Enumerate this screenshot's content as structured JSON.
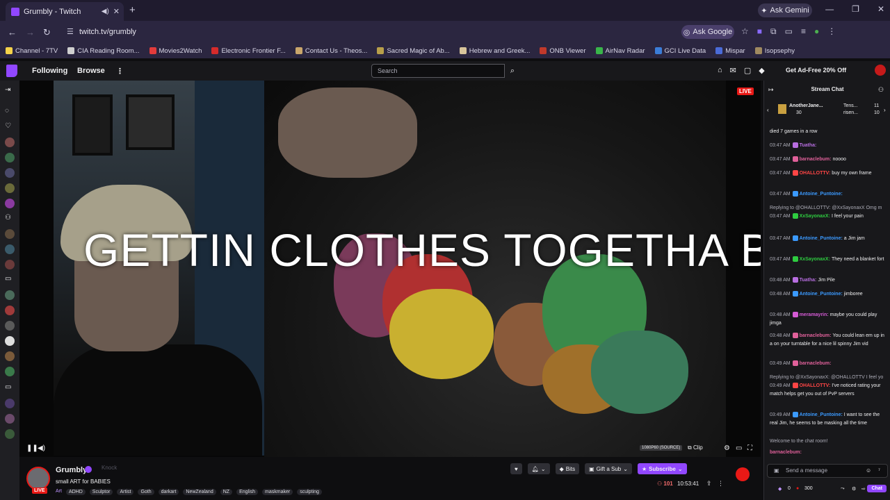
{
  "browser": {
    "tab_title": "Grumbly - Twitch",
    "new_tab": "+",
    "ask_gemini": "Ask Gemini",
    "url": "twitch.tv/grumbly",
    "ask_google": "Ask Google",
    "bookmarks": [
      {
        "label": "Channel - 7TV",
        "color": "#f5d24a"
      },
      {
        "label": "CIA Reading Room...",
        "color": "#cfcfcf"
      },
      {
        "label": "Movies2Watch",
        "color": "#e23b3b"
      },
      {
        "label": "Electronic Frontier F...",
        "color": "#d62b2b"
      },
      {
        "label": "Contact Us - Theos...",
        "color": "#c9a66b"
      },
      {
        "label": "Sacred Magic of Ab...",
        "color": "#b89f4a"
      },
      {
        "label": "Hebrew and Greek...",
        "color": "#d8c49a"
      },
      {
        "label": "ONB Viewer",
        "color": "#c0392b"
      },
      {
        "label": "AirNav Radar",
        "color": "#39b54a"
      },
      {
        "label": "GCI Live Data",
        "color": "#3b7dd8"
      },
      {
        "label": "Mispar",
        "color": "#4a6bd8"
      },
      {
        "label": "Isopsephy",
        "color": "#a08a60"
      }
    ]
  },
  "twitch": {
    "following": "Following",
    "browse": "Browse",
    "search_placeholder": "Search",
    "ad_free": "Get Ad-Free 20% Off",
    "notif_count": "8"
  },
  "video": {
    "live_badge": "LIVE",
    "overlay_text": "GETTIN CLOTHES TOGETHA BRB",
    "quality": "1080P60 (SOURCE)",
    "clip": "Clip"
  },
  "channel": {
    "name": "Grumbly",
    "live": "LIVE",
    "knock": "Knock",
    "title": "small ART for BABIES",
    "category": "Art",
    "tags": [
      "ADHD",
      "Sculptor",
      "Artist",
      "Goth",
      "darkart",
      "NewZealand",
      "NZ",
      "English",
      "maskmaker",
      "sculpting"
    ],
    "bits": "Bits",
    "gift_sub": "Gift a Sub",
    "subscribe": "Subscribe",
    "viewers": "101",
    "uptime": "10:53:41"
  },
  "chat": {
    "header": "Stream Chat",
    "gift_user1": "AnotherJane...",
    "gift_count1": "30",
    "gift_user2": "Tens...",
    "gift_count2": "11",
    "gift_user3": "risen...",
    "gift_count3": "10",
    "messages": [
      {
        "time": "",
        "user": "",
        "color": "#efeff1",
        "text": "died 7 games in a row"
      },
      {
        "time": "03:47 AM",
        "user": "Tuatha:",
        "color": "#b86ee0",
        "text": ""
      },
      {
        "time": "03:47 AM",
        "user": "barnaclebum:",
        "color": "#e0609a",
        "text": "noooo"
      },
      {
        "time": "03:47 AM",
        "user": "OHALLOTTV:",
        "color": "#ff4545",
        "text": "buy my own frame"
      },
      {
        "time": "03:47 AM",
        "user": "Antoine_Puntoine:",
        "color": "#3b9aff",
        "text": ""
      },
      {
        "time": "",
        "user": "",
        "color": "#adadb8",
        "text": "Replying to @OHALLOTTV: @XxSayonaxX Omg m"
      },
      {
        "time": "03:47 AM",
        "user": "XxSayonaxX:",
        "color": "#2ecc40",
        "text": "I feel your pain"
      },
      {
        "time": "03:47 AM",
        "user": "Antoine_Puntoine:",
        "color": "#3b9aff",
        "text": "a Jim jam"
      },
      {
        "time": "03:47 AM",
        "user": "XxSayonaxX:",
        "color": "#2ecc40",
        "text": "They need a blanket fort"
      },
      {
        "time": "03:48 AM",
        "user": "Tuatha:",
        "color": "#b86ee0",
        "text": "Jim Pile"
      },
      {
        "time": "03:48 AM",
        "user": "Antoine_Puntoine:",
        "color": "#3b9aff",
        "text": "jimboree"
      },
      {
        "time": "03:48 AM",
        "user": "meramayrin:",
        "color": "#d65bd6",
        "text": "maybe you could play jimga"
      },
      {
        "time": "03:48 AM",
        "user": "barnaclebum:",
        "color": "#e0609a",
        "text": "You could lean em up in a on your turntable for a nice lil spinny Jim vid"
      },
      {
        "time": "03:49 AM",
        "user": "barnaclebum:",
        "color": "#e0609a",
        "text": ""
      },
      {
        "time": "",
        "user": "",
        "color": "#adadb8",
        "text": "Replying to @XxSayonaxX: @OHALLOTTV I feel yo"
      },
      {
        "time": "03:49 AM",
        "user": "OHALLOTTV:",
        "color": "#ff4545",
        "text": "I've noticed rating your match helps get you out of PvP servers"
      },
      {
        "time": "03:49 AM",
        "user": "Antoine_Puntoine:",
        "color": "#3b9aff",
        "text": "I want to see the real Jim, he seems to be masking all the time"
      },
      {
        "time": "",
        "user": "",
        "color": "#adadb8",
        "text": "Welcome to the chat room!"
      },
      {
        "time": "",
        "user": "barnaclebum:",
        "color": "#e0609a",
        "text": ""
      }
    ],
    "input_placeholder": "Send a message",
    "points": "300",
    "bits_count": "0",
    "chat_button": "Chat"
  }
}
